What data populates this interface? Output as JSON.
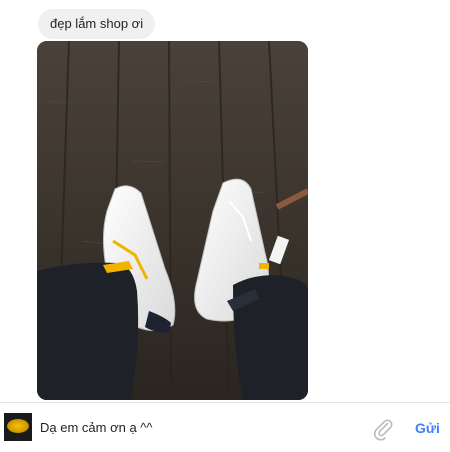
{
  "conversation": {
    "incoming_message": "đẹp lắm shop ơi",
    "incoming_photo": "customer-shoes-photo"
  },
  "composer": {
    "draft_text": "Dạ em cảm ơn ạ ^^",
    "attach_icon": "paperclip-icon",
    "send_label": "Gửi",
    "send_color": "#4080ff"
  },
  "avatar": {
    "brand_color": "#f5c400"
  }
}
